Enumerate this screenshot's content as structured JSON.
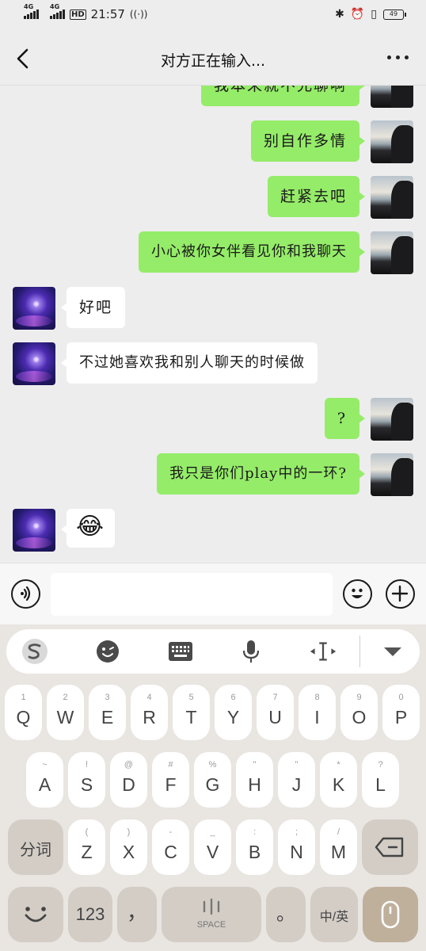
{
  "status_bar": {
    "signal1_label": "4G",
    "signal2_label": "4G",
    "hd_label": "HD",
    "time": "21:57",
    "battery": "49"
  },
  "header": {
    "title": "对方正在输入..."
  },
  "messages": [
    {
      "side": "right",
      "text": "我本来就不允聊啊"
    },
    {
      "side": "right",
      "text": "别自作多情"
    },
    {
      "side": "right",
      "text": "赶紧去吧"
    },
    {
      "side": "right",
      "text": "小心被你女伴看见你和我聊天"
    },
    {
      "side": "left",
      "text": "好吧"
    },
    {
      "side": "left",
      "text": "不过她喜欢我和别人聊天的时候做"
    },
    {
      "side": "right",
      "text": "?"
    },
    {
      "side": "right",
      "text": "我只是你们play中的一环?"
    },
    {
      "side": "left",
      "text": "😂"
    }
  ],
  "keyboard": {
    "row1": [
      {
        "main": "Q",
        "sub": "1"
      },
      {
        "main": "W",
        "sub": "2"
      },
      {
        "main": "E",
        "sub": "3"
      },
      {
        "main": "R",
        "sub": "4"
      },
      {
        "main": "T",
        "sub": "5"
      },
      {
        "main": "Y",
        "sub": "6"
      },
      {
        "main": "U",
        "sub": "7"
      },
      {
        "main": "I",
        "sub": "8"
      },
      {
        "main": "O",
        "sub": "9"
      },
      {
        "main": "P",
        "sub": "0"
      }
    ],
    "row2": [
      {
        "main": "A",
        "sub": "~"
      },
      {
        "main": "S",
        "sub": "!"
      },
      {
        "main": "D",
        "sub": "@"
      },
      {
        "main": "F",
        "sub": "#"
      },
      {
        "main": "G",
        "sub": "%"
      },
      {
        "main": "H",
        "sub": "\""
      },
      {
        "main": "J",
        "sub": "\""
      },
      {
        "main": "K",
        "sub": "*"
      },
      {
        "main": "L",
        "sub": "?"
      }
    ],
    "row3": [
      {
        "main": "Z",
        "sub": "("
      },
      {
        "main": "X",
        "sub": ")"
      },
      {
        "main": "C",
        "sub": "-"
      },
      {
        "main": "V",
        "sub": "_"
      },
      {
        "main": "B",
        "sub": ":"
      },
      {
        "main": "N",
        "sub": ";"
      },
      {
        "main": "M",
        "sub": "/"
      }
    ],
    "fenci": "分词",
    "num": "123",
    "comma": "，",
    "space": "SPACE",
    "period": "。",
    "lang": "中/英"
  }
}
